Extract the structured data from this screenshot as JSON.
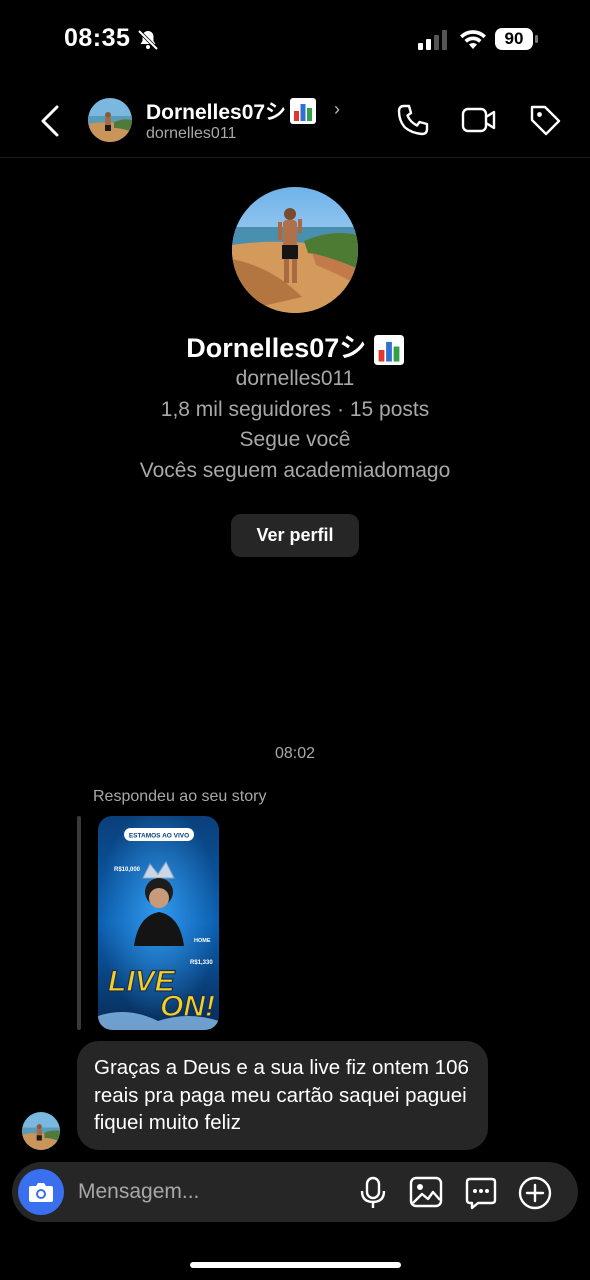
{
  "status_bar": {
    "time": "08:35",
    "battery": "90"
  },
  "header": {
    "name": "Dornelles07シ",
    "username": "dornelles011",
    "chevron": "›"
  },
  "profile": {
    "name": "Dornelles07シ",
    "username": "dornelles011",
    "stats": "1,8 mil seguidores · 15 posts",
    "follows_you": "Segue você",
    "mutual": "Vocês seguem academiadomago",
    "view_profile_label": "Ver perfil"
  },
  "chat": {
    "timestamp": "08:02",
    "reply_label": "Respondeu ao seu story",
    "story": {
      "top_badge": "ESTAMOS AO VIVO",
      "value_left": "R$10,000",
      "value_right": "R$1,330",
      "side_tag": "HOME",
      "headline_1": "LIVE",
      "headline_2": "ON!"
    },
    "message": "Graças a Deus e a sua live fiz ontem 106 reais pra paga meu cartão saquei paguei fiquei muito feliz"
  },
  "composer": {
    "placeholder": "Mensagem..."
  },
  "colors": {
    "accent": "#3a6ff0",
    "bubble": "#262626",
    "secondary_text": "#a8a8a8"
  }
}
